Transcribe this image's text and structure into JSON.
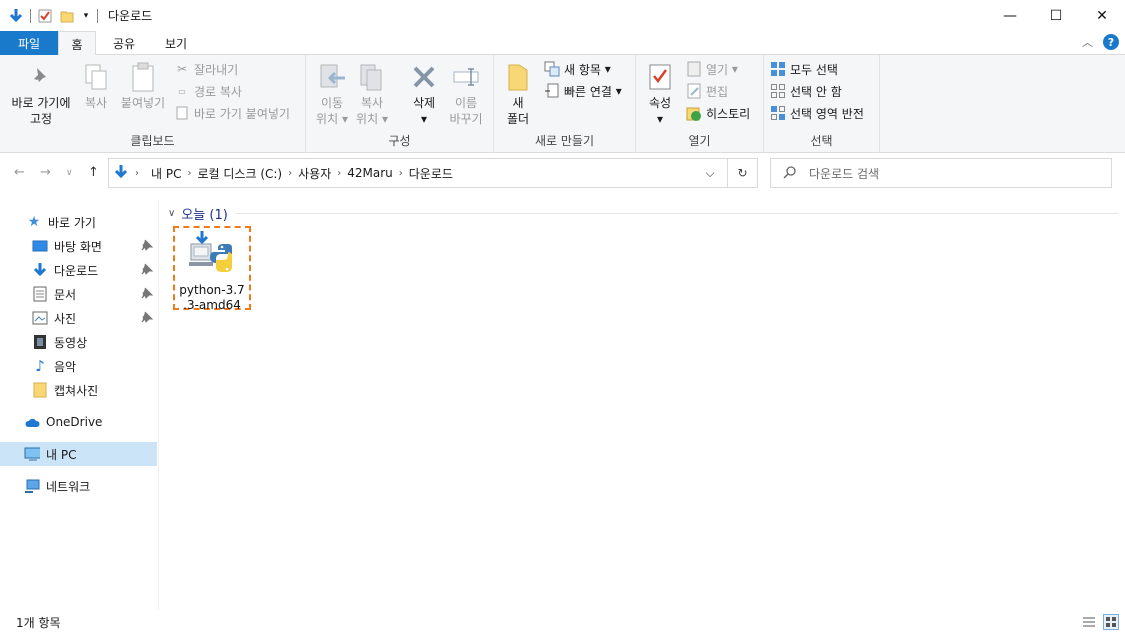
{
  "window": {
    "title": "다운로드",
    "controls": {
      "minimize": "—",
      "maximize": "☐",
      "close": "✕"
    }
  },
  "tabs": {
    "file": "파일",
    "home": "홈",
    "share": "공유",
    "view": "보기"
  },
  "ribbon": {
    "clipboard": {
      "label": "클립보드",
      "pin": "바로 가기에",
      "pin2": "고정",
      "copy": "복사",
      "paste": "붙여넣기",
      "cut": "잘라내기",
      "copy_path": "경로 복사",
      "paste_shortcut": "바로 가기 붙여넣기"
    },
    "organize": {
      "label": "구성",
      "move": "이동",
      "move2": "위치",
      "copyto": "복사",
      "copyto2": "위치",
      "delete": "삭제",
      "rename": "이름",
      "rename2": "바꾸기"
    },
    "new": {
      "label": "새로 만들기",
      "new_folder": "새",
      "new_folder2": "폴더",
      "new_item": "새 항목",
      "easy_access": "빠른 연결"
    },
    "open": {
      "label": "열기",
      "properties": "속성",
      "open": "열기",
      "edit": "편집",
      "history": "히스토리"
    },
    "select": {
      "label": "선택",
      "select_all": "모두 선택",
      "select_none": "선택 안 함",
      "invert": "선택 영역 반전"
    }
  },
  "address": {
    "breadcrumbs": [
      "내 PC",
      "로컬 디스크 (C:)",
      "사용자",
      "42Maru",
      "다운로드"
    ]
  },
  "search": {
    "placeholder": "다운로드 검색"
  },
  "sidebar": {
    "quick_access": "바로 가기",
    "items": [
      {
        "label": "바탕 화면",
        "pinned": true
      },
      {
        "label": "다운로드",
        "pinned": true
      },
      {
        "label": "문서",
        "pinned": true
      },
      {
        "label": "사진",
        "pinned": true
      },
      {
        "label": "동영상",
        "pinned": false
      },
      {
        "label": "음악",
        "pinned": false
      },
      {
        "label": "캡쳐사진",
        "pinned": false
      }
    ],
    "onedrive": "OneDrive",
    "this_pc": "내 PC",
    "network": "네트워크"
  },
  "content": {
    "group_header": "오늘 (1)",
    "files": [
      {
        "name_line1": "python-3.7",
        "name_line2": ".3-amd64",
        "icon": "python-installer-icon"
      }
    ]
  },
  "status": {
    "count": "1개 항목"
  },
  "colors": {
    "accent": "#1979ca",
    "highlight": "#f07a1a",
    "selected": "#cce4f7"
  }
}
